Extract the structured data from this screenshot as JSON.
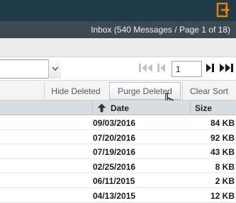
{
  "status": {
    "text": "Inbox (540 Messages / Page 1 of 18)"
  },
  "pager": {
    "page_value": "1"
  },
  "actions": {
    "hide_deleted": "Hide Deleted",
    "purge_deleted": "Purge Deleted",
    "clear_sort": "Clear Sort"
  },
  "table": {
    "columns": [
      {
        "label": "Date"
      },
      {
        "label": "Size"
      }
    ],
    "rows": [
      {
        "date": "09/03/2016",
        "size": "84 KB"
      },
      {
        "date": "07/20/2016",
        "size": "92 KB"
      },
      {
        "date": "07/19/2016",
        "size": "43 KB"
      },
      {
        "date": "02/25/2016",
        "size": "8 KB"
      },
      {
        "date": "06/11/2015",
        "size": "2 KB"
      },
      {
        "date": "04/13/2015",
        "size": "12 KB"
      }
    ]
  },
  "colors": {
    "topbar": "#1f3a48",
    "statusbar": "#3e4a52",
    "logout_accent": "#f07d00"
  }
}
